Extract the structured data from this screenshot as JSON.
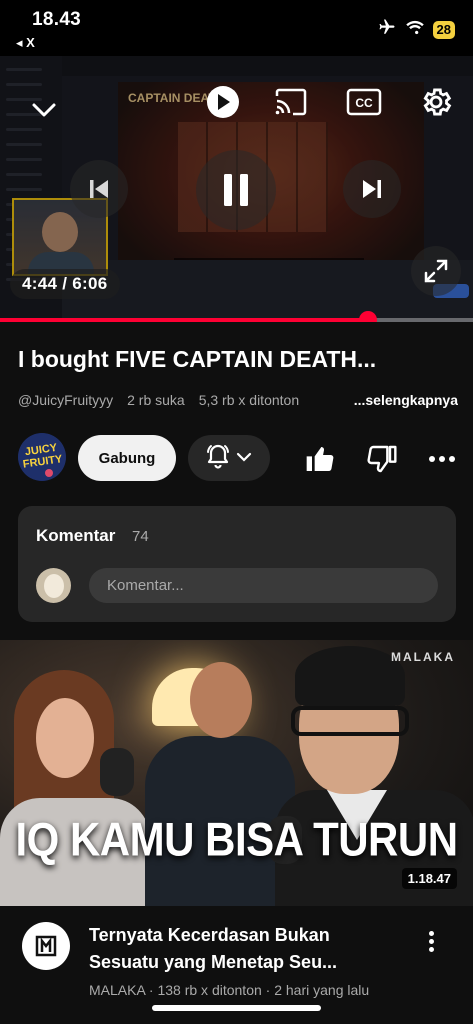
{
  "status_bar": {
    "time": "18.43",
    "back_label": "◂ X",
    "battery": "28"
  },
  "player": {
    "time_label": "4:44 / 6:06",
    "progress_fraction": 0.777,
    "overlay_game_title": "CAPTAIN DEATH"
  },
  "video": {
    "title": "I bought FIVE CAPTAIN DEATH...",
    "channel": "@JuicyFruityyy",
    "likes": "2 rb suka",
    "views": "5,3 rb x ditonton",
    "more_label": "...selengkapnya",
    "join_label": "Gabung"
  },
  "comments": {
    "heading": "Komentar",
    "count": "74",
    "placeholder": "Komentar..."
  },
  "next_video": {
    "brand": "MALAKA",
    "headline": "IQ KAMU BISA TURUN",
    "duration": "1.18.47",
    "title_line1": "Ternyata Kecerdasan Bukan",
    "title_line2": "Sesuatu yang Menetap Seu...",
    "meta": "MALAKA · 138 rb x ditonton · 2 hari yang lalu"
  },
  "colors": {
    "background": "#0f0f0f",
    "accent_red": "#ff0033",
    "card": "#272727"
  },
  "icons": [
    "airplane-icon",
    "wifi-icon",
    "battery-icon",
    "chevron-down-icon",
    "play-icon",
    "cast-icon",
    "captions-icon",
    "gear-icon",
    "previous-icon",
    "pause-icon",
    "next-icon",
    "fullscreen-icon",
    "bell-icon",
    "like-icon",
    "dislike-icon",
    "more-icon"
  ]
}
